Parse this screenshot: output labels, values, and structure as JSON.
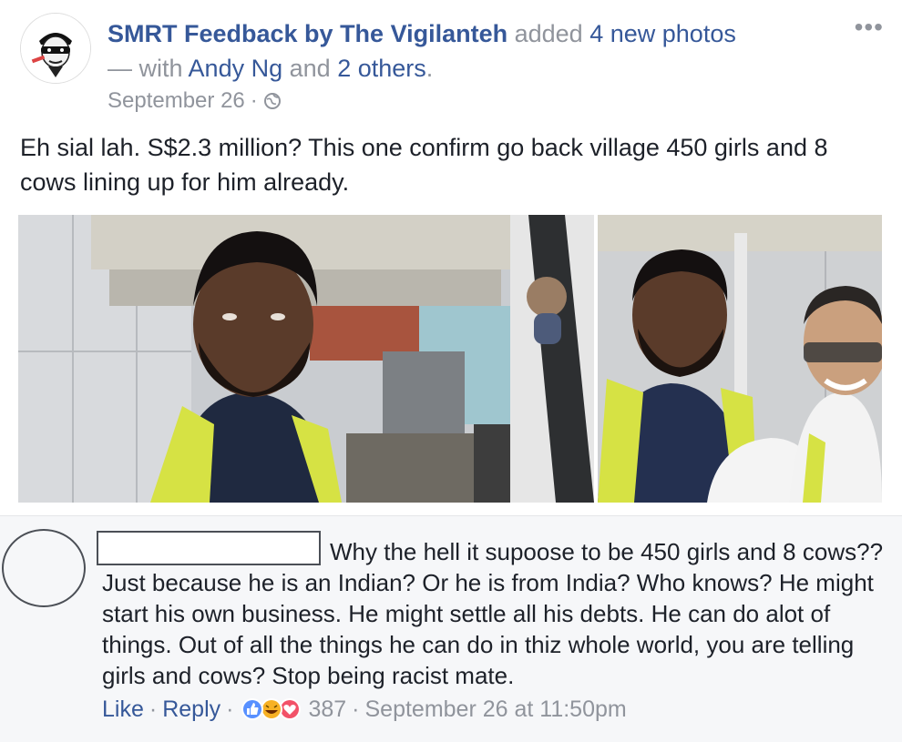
{
  "post": {
    "page_name": "SMRT Feedback by The Vigilanteh",
    "action_text": "added",
    "photos_link": "4 new photos",
    "with_prefix": "— with",
    "tagged_person": "Andy Ng",
    "and_text": "and",
    "others_link": "2 others",
    "period": ".",
    "date": "September 26",
    "separator": "·",
    "audience_icon": "globe-icon",
    "more_icon": "more-options-icon",
    "more_label": "•••",
    "text": "Eh sial lah. S$2.3 million? This one confirm go back village 450 girls and 8 cows lining up for him already."
  },
  "comment": {
    "first_line": "Why the hell it supoose to be 450 girls and 8 cows??",
    "rest": "Just because he is an Indian? Or he is from India? Who knows? He might start his own business. He might settle all his debts. He can do alot of things. Out of all the things he can do in thiz whole world, you are telling girls and cows? Stop being racist mate.",
    "like_label": "Like",
    "reply_label": "Reply",
    "dot": "·",
    "reaction_icons": [
      "like-reaction-icon",
      "haha-reaction-icon",
      "love-reaction-icon"
    ],
    "reaction_count": "387",
    "timestamp": "September 26 at 11:50pm"
  },
  "colors": {
    "link": "#365899",
    "meta": "#90949c",
    "text": "#1d2129",
    "comment_bg": "#f6f7f9",
    "like_blue": "#5890ff",
    "haha_yellow": "#f7b125",
    "love_red": "#f25268"
  }
}
